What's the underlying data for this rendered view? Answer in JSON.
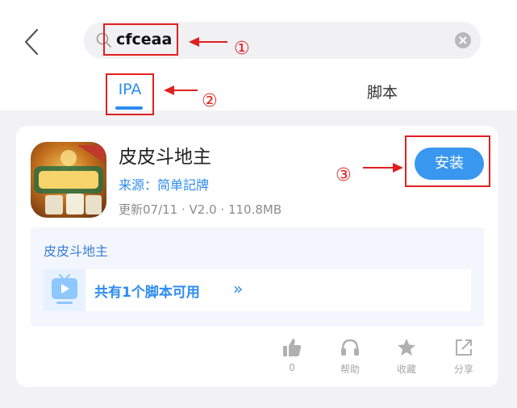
{
  "search": {
    "query": "cfceaa"
  },
  "tabs": [
    {
      "label": "IPA",
      "active": true
    },
    {
      "label": "脚本",
      "active": false
    }
  ],
  "annotations": {
    "step1": "①",
    "step2": "②",
    "step3": "③"
  },
  "app": {
    "name": "皮皮斗地主",
    "source": "来源：简单記牌",
    "meta": "更新07/11 · V2.0 · 110.8MB",
    "install_label": "安装",
    "icon_name": "app-icon-game"
  },
  "script_panel": {
    "title": "皮皮斗地主",
    "row_label": "共有1个脚本可用",
    "chevron": "»"
  },
  "actions": [
    {
      "icon": "thumbs-up-icon",
      "label": "0"
    },
    {
      "icon": "headset-icon",
      "label": "帮助"
    },
    {
      "icon": "star-icon",
      "label": "收藏"
    },
    {
      "icon": "share-icon",
      "label": "分享"
    }
  ],
  "colors": {
    "accent": "#2d8cf0",
    "install_button": "#3a97ef",
    "annotation_red": "#e02020",
    "background": "#f2f2f4"
  }
}
